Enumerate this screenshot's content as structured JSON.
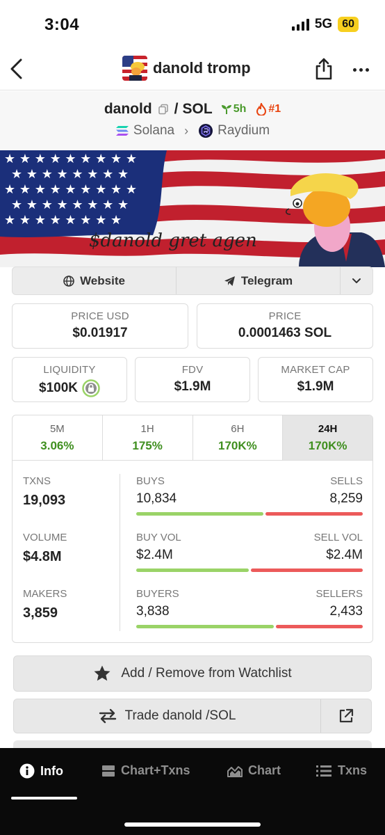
{
  "status": {
    "time": "3:04",
    "network": "5G",
    "battery": "60"
  },
  "header": {
    "title": "danold tromp"
  },
  "pair": {
    "base": "danold",
    "separator": "/",
    "quote": "SOL",
    "age": "5h",
    "rank": "#1",
    "chain": "Solana",
    "dex": "Raydium"
  },
  "banner": {
    "text": "$danold gret agen"
  },
  "links": {
    "website": "Website",
    "telegram": "Telegram"
  },
  "prices": {
    "price_usd_label": "PRICE USD",
    "price_usd": "$0.01917",
    "price_label": "PRICE",
    "price_native": "0.0001463 SOL",
    "liquidity_label": "LIQUIDITY",
    "liquidity": "$100K",
    "fdv_label": "FDV",
    "fdv": "$1.9M",
    "mcap_label": "MARKET CAP",
    "mcap": "$1.9M"
  },
  "timeframes": [
    {
      "label": "5M",
      "value": "3.06%"
    },
    {
      "label": "1H",
      "value": "175%"
    },
    {
      "label": "6H",
      "value": "170K%"
    },
    {
      "label": "24H",
      "value": "170K%",
      "active": true
    }
  ],
  "metrics": {
    "txns_label": "TXNS",
    "txns": "19,093",
    "volume_label": "VOLUME",
    "volume": "$4.8M",
    "makers_label": "MAKERS",
    "makers": "3,859",
    "buys_label": "BUYS",
    "buys": "10,834",
    "sells_label": "SELLS",
    "sells": "8,259",
    "buy_vol_label": "BUY VOL",
    "buy_vol": "$2.4M",
    "sell_vol_label": "SELL VOL",
    "sell_vol": "$2.4M",
    "buyers_label": "BUYERS",
    "buyers": "3,838",
    "sellers_label": "SELLERS",
    "sellers": "2,433",
    "buy_share_txns": 0.567,
    "buy_share_vol": 0.5,
    "buy_share_makers": 0.612
  },
  "actions": {
    "watchlist": "Add / Remove from Watchlist",
    "trade": "Trade danold /SOL"
  },
  "nav": {
    "info": "Info",
    "chart_txns": "Chart+Txns",
    "chart": "Chart",
    "txns": "Txns"
  },
  "colors": {
    "positive": "#3f8f1f",
    "buy_bar": "#9ad367",
    "sell_bar": "#ec5a5a",
    "fire": "#e8430f",
    "battery": "#f7cf1f"
  }
}
